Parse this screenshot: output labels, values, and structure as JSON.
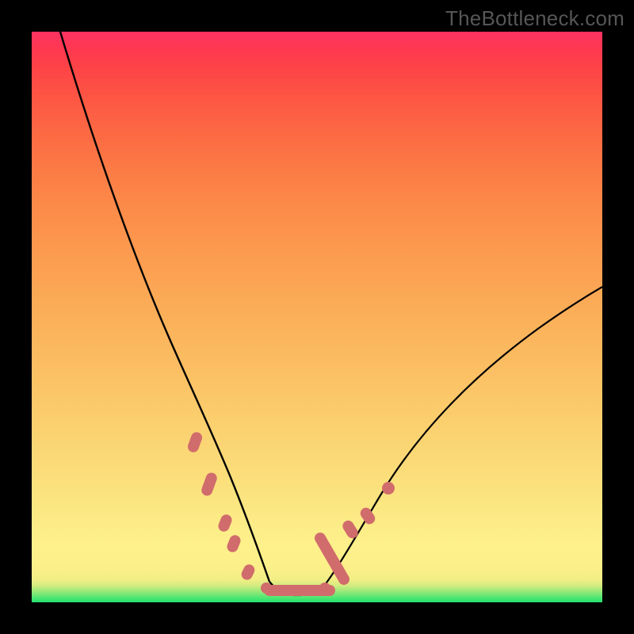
{
  "watermark": "TheBottleneck.com",
  "colors": {
    "dot": "#d16c6c",
    "curve": "#000000"
  },
  "chart_data": {
    "type": "line",
    "title": "",
    "xlabel": "",
    "ylabel": "",
    "xlim": [
      0,
      100
    ],
    "ylim": [
      0,
      100
    ],
    "annotations": [
      "TheBottleneck.com"
    ],
    "series": [
      {
        "name": "left-branch",
        "x": [
          5,
          10,
          15,
          19,
          22,
          25,
          27,
          29,
          31,
          33,
          34,
          35.5,
          37,
          38.5,
          40,
          41.5
        ],
        "y": [
          100,
          79,
          63,
          52,
          44,
          37,
          31,
          26,
          21,
          16,
          13,
          10,
          7,
          5,
          3,
          1.5
        ]
      },
      {
        "name": "floor",
        "x": [
          41.5,
          44,
          47,
          50
        ],
        "y": [
          1.5,
          1,
          1,
          1.2
        ]
      },
      {
        "name": "right-branch",
        "x": [
          50,
          52,
          54,
          56,
          58,
          61,
          64,
          68,
          73,
          79,
          86,
          94,
          100
        ],
        "y": [
          1.2,
          3,
          6,
          9,
          12,
          16,
          20.5,
          25.5,
          31,
          37,
          43,
          50,
          55
        ]
      }
    ],
    "dot_clusters": [
      {
        "name": "left-upper-pair",
        "points": [
          [
            28.4,
            28.5
          ],
          [
            28.9,
            27.0
          ]
        ]
      },
      {
        "name": "left-mid-triple",
        "points": [
          [
            30.6,
            22.0
          ],
          [
            31.2,
            20.5
          ],
          [
            31.6,
            19.3
          ]
        ]
      },
      {
        "name": "left-lower-a",
        "points": [
          [
            33.6,
            14.2
          ],
          [
            34.1,
            13.0
          ]
        ]
      },
      {
        "name": "left-lower-b",
        "points": [
          [
            35.0,
            11.0
          ],
          [
            35.5,
            9.8
          ]
        ]
      },
      {
        "name": "left-near-base",
        "points": [
          [
            37.5,
            6.0
          ],
          [
            38.1,
            5.0
          ]
        ]
      },
      {
        "name": "floor-blobs",
        "points": [
          [
            41.2,
            1.8
          ],
          [
            42.5,
            1.4
          ],
          [
            43.8,
            1.2
          ],
          [
            45.2,
            1.1
          ],
          [
            46.8,
            1.0
          ],
          [
            48.0,
            1.0
          ],
          [
            49.0,
            1.0
          ],
          [
            50.3,
            1.3
          ],
          [
            51.3,
            2.0
          ]
        ]
      },
      {
        "name": "right-low",
        "points": [
          [
            52.6,
            4.2
          ],
          [
            53.3,
            5.4
          ],
          [
            54.2,
            7.0
          ],
          [
            55.1,
            8.5
          ],
          [
            55.8,
            9.7
          ],
          [
            56.5,
            10.8
          ],
          [
            57.5,
            12.3
          ]
        ]
      },
      {
        "name": "right-mid-pair",
        "points": [
          [
            59.0,
            14.6
          ],
          [
            59.6,
            15.6
          ]
        ]
      },
      {
        "name": "right-single",
        "points": [
          [
            62.6,
            20.0
          ]
        ]
      }
    ]
  }
}
